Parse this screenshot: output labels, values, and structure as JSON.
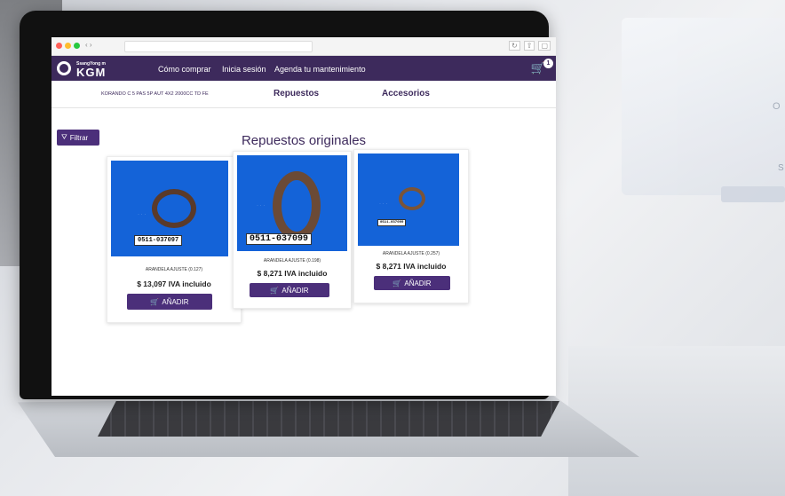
{
  "background": {
    "right_glyph": "O",
    "lower_glyph": "S"
  },
  "site": {
    "brand_small": "SsangYong m",
    "brand": "KGM",
    "nav": [
      "Cómo comprar",
      "Inicia sesión",
      "Agenda tu mantenimiento"
    ],
    "cart_count": "1"
  },
  "subnav": {
    "model": "KORANDO C 5 PAS 5P AUT 4X2 2000CC TD FE",
    "tabs": [
      "Repuestos",
      "Accesorios"
    ]
  },
  "main": {
    "filter_label": "Filtrar",
    "title": "Repuestos originales",
    "products": [
      {
        "code": "0511-037097",
        "name": "ARANDELA AJUSTE (0.127)",
        "price": "$ 13,097 IVA incluido",
        "button": "AÑADIR"
      },
      {
        "code": "0511-037099",
        "name": "ARANDELA AJUSTE (0.198)",
        "price": "$ 8,271 IVA incluido",
        "button": "AÑADIR"
      },
      {
        "code": "0511-037099",
        "name": "ARANDELA AJUSTE (0.257)",
        "price": "$ 8,271 IVA incluido",
        "button": "AÑADIR"
      }
    ]
  },
  "colors": {
    "brand_purple": "#3d2a5c",
    "button_purple": "#4b2f7a",
    "product_blue": "#1463d8"
  }
}
